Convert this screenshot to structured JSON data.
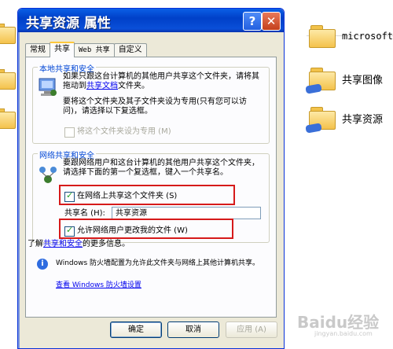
{
  "background": {
    "items": [
      {
        "label": "microsoft",
        "icon": "folder-icon"
      },
      {
        "label": "共享图像",
        "icon": "shared-folder-icon"
      },
      {
        "label": "共享资源",
        "icon": "shared-folder-icon"
      }
    ]
  },
  "dialog": {
    "title": "共享资源 属性",
    "help_glyph": "?",
    "close_glyph": "✕",
    "tabs": [
      {
        "label": "常规",
        "active": false
      },
      {
        "label": "共享",
        "active": true
      },
      {
        "label": "Web 共享",
        "active": false
      },
      {
        "label": "自定义",
        "active": false
      }
    ],
    "local": {
      "title": "本地共享和安全",
      "text1_pre": "如果只跟这台计算机的其他用户共享这个文件夹，请将其拖动到",
      "text1_link": "共享文档",
      "text1_post": "文件夹。",
      "text2": "要将这个文件夹及其子文件夹设为专用(只有您可以访问)，请选择以下复选框。",
      "private_checkbox_label": "将这个文件夹设为专用 (M)",
      "private_checked": false
    },
    "network": {
      "title": "网络共享和安全",
      "text": "要跟网络用户和这台计算机的其他用户共享这个文件夹，请选择下面的第一个复选框，键入一个共享名。",
      "share_checkbox_label": "在网络上共享这个文件夹 (S)",
      "share_checked": true,
      "share_name_label": "共享名 (H):",
      "share_name_value": "共享资源",
      "allow_change_label": "允许网络用户更改我的文件 (W)",
      "allow_change_checked": true
    },
    "learn_more_pre": "了解",
    "learn_more_link": "共享和安全",
    "learn_more_post": "的更多信息。",
    "firewall_text": "Windows 防火墙配置为允许此文件夹与网络上其他计算机共享。",
    "firewall_link": "查看 Windows 防火墙设置",
    "buttons": {
      "ok": "确定",
      "cancel": "取消",
      "apply": "应用 (A)"
    }
  },
  "watermark": {
    "text": "Baidu经验",
    "sub": "jingyan.baidu.com"
  },
  "colors": {
    "titlebar": "#0a4fd8",
    "highlight_box": "#d61a1a",
    "link": "#0000ee"
  }
}
